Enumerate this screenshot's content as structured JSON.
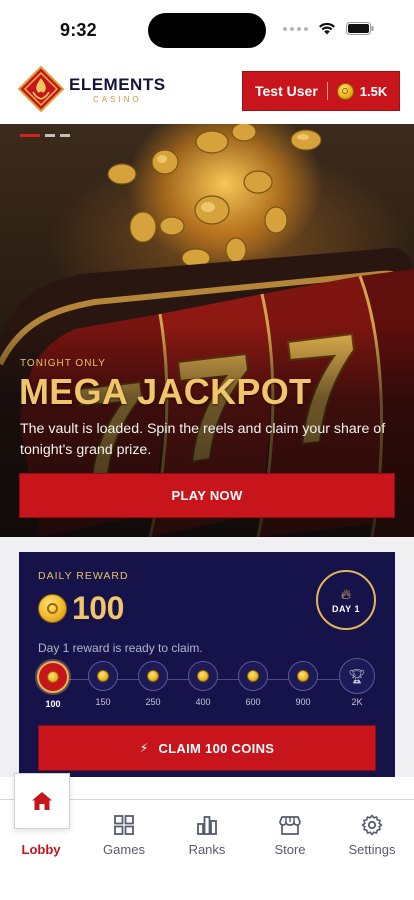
{
  "status_bar": {
    "time": "9:32"
  },
  "brand": {
    "name": "ELEMENTS",
    "sub": "CASINO"
  },
  "user": {
    "name": "Test User",
    "balance": "1.5K"
  },
  "hero": {
    "kicker": "TONIGHT ONLY",
    "title": "MEGA JACKPOT",
    "description": "The vault is loaded. Spin the reels and claim your share of tonight's grand prize.",
    "cta": "PLAY NOW",
    "slides": 3,
    "active_slide": 1
  },
  "reward": {
    "label": "DAILY REWARD",
    "amount": "100",
    "note": "Day 1 reward is ready to claim.",
    "day_badge": "DAY 1",
    "steps": [
      "100",
      "150",
      "250",
      "400",
      "600",
      "900",
      "2K"
    ],
    "claim_label": "CLAIM 100 COINS"
  },
  "tabs": {
    "lobby": "Lobby",
    "games": "Games",
    "ranks": "Ranks",
    "store": "Store",
    "settings": "Settings",
    "active": "Lobby"
  },
  "colors": {
    "brand_red": "#c8151b",
    "gold": "#f1c56a",
    "navy": "#16134a"
  }
}
